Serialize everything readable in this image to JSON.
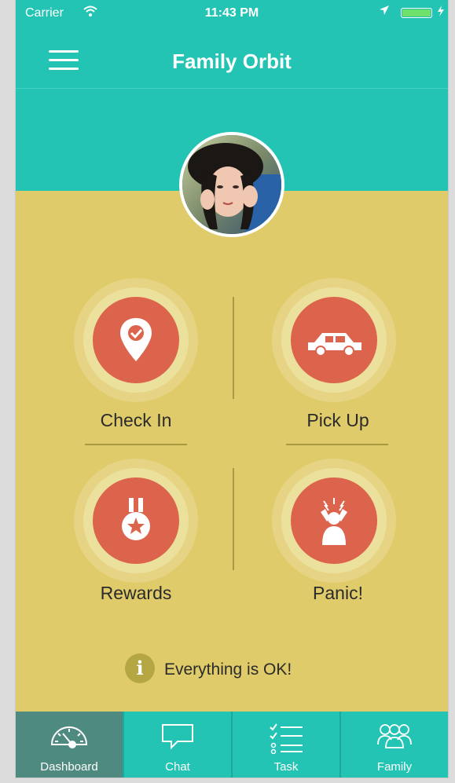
{
  "status_bar": {
    "carrier": "Carrier",
    "time": "11:43 PM"
  },
  "navbar": {
    "title": "Family Orbit"
  },
  "actions": [
    {
      "label": "Check In",
      "icon": "location-check-icon"
    },
    {
      "label": "Pick Up",
      "icon": "car-icon"
    },
    {
      "label": "Rewards",
      "icon": "medal-icon"
    },
    {
      "label": "Panic!",
      "icon": "panic-person-icon"
    }
  ],
  "status": {
    "icon_glyph": "i",
    "text": "Everything is OK!"
  },
  "tabs": [
    {
      "label": "Dashboard",
      "icon": "speedometer-icon",
      "active": true
    },
    {
      "label": "Chat",
      "icon": "chat-bubble-icon",
      "active": false
    },
    {
      "label": "Task",
      "icon": "checklist-icon",
      "active": false
    },
    {
      "label": "Family",
      "icon": "people-icon",
      "active": false
    }
  ],
  "colors": {
    "header_teal": "#23c4b3",
    "body_yellow": "#dfcb6a",
    "button_red": "#dc634c",
    "active_tab": "#4f8a80"
  }
}
